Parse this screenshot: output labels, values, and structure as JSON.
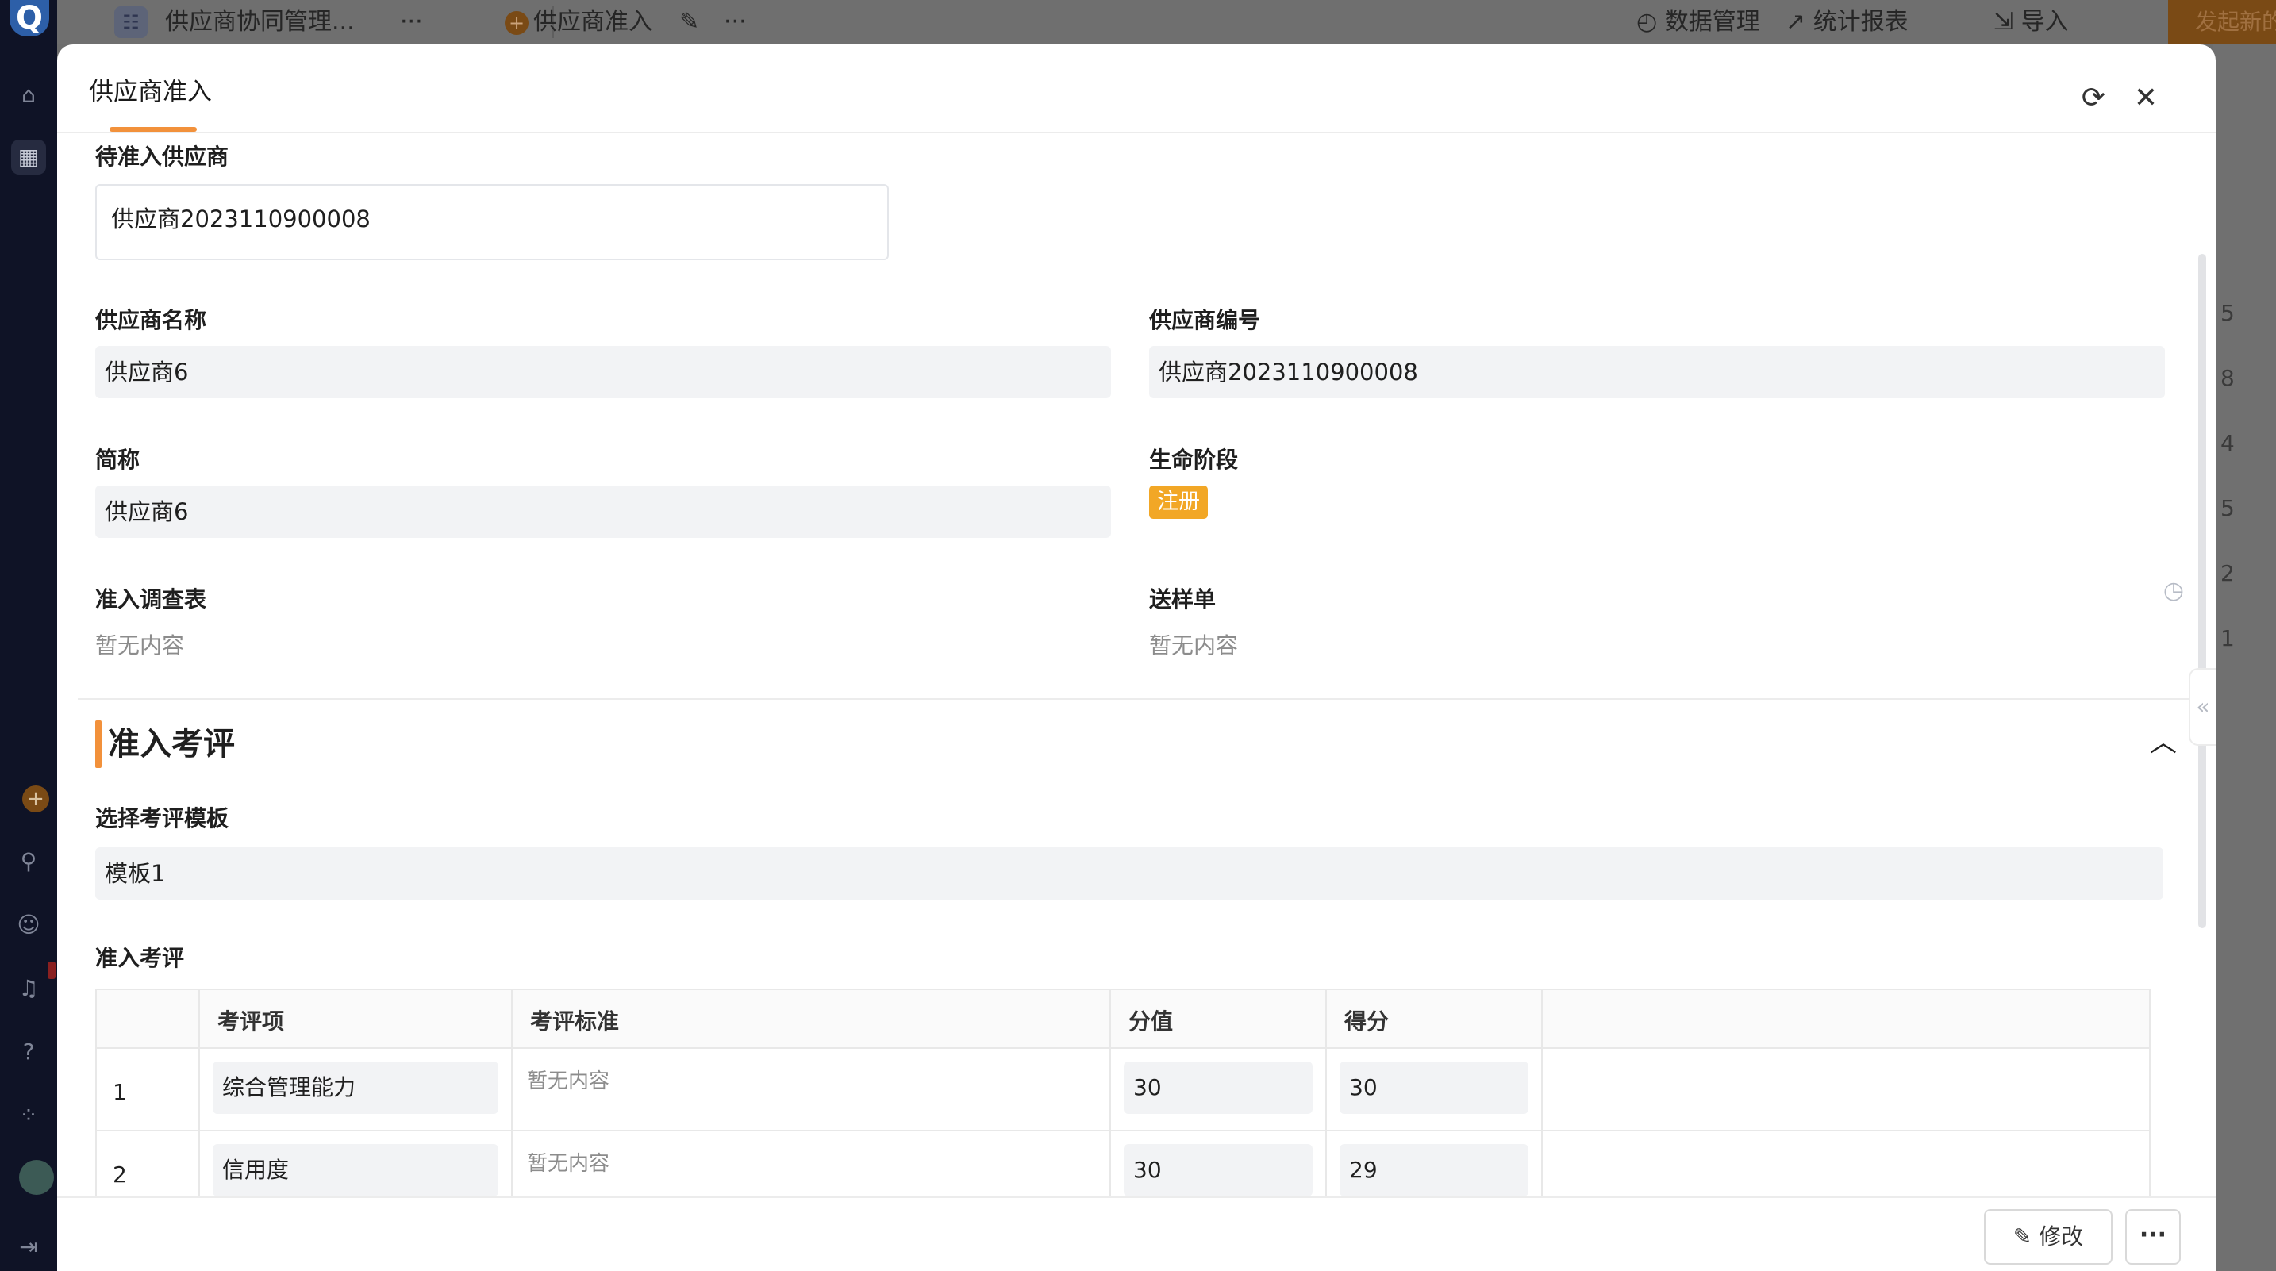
{
  "background": {
    "rail_logo": "Q",
    "topbar": {
      "app_name": "供应商协同管理...",
      "app_more": "···",
      "page_name": "供应商准入",
      "page_more": "···",
      "data_manage": "数据管理",
      "reports": "统计报表",
      "import": "导入",
      "start_new": "发起新的"
    },
    "right_edge_digits": [
      "5",
      "8",
      "4",
      "5",
      "2",
      "1"
    ]
  },
  "modal": {
    "title": "供应商准入",
    "fields": {
      "pending_supplier": {
        "label": "待准入供应商",
        "value": "供应商2023110900008"
      },
      "supplier_name": {
        "label": "供应商名称",
        "value": "供应商6"
      },
      "supplier_code": {
        "label": "供应商编号",
        "value": "供应商2023110900008"
      },
      "short_name": {
        "label": "简称",
        "value": "供应商6"
      },
      "lifecycle": {
        "label": "生命阶段",
        "value": "注册"
      },
      "survey": {
        "label": "准入调查表",
        "value": "暂无内容"
      },
      "sample_order": {
        "label": "送样单",
        "value": "暂无内容"
      }
    },
    "section": {
      "title": "准入考评",
      "template": {
        "label": "选择考评模板",
        "value": "模板1"
      },
      "table_label": "准入考评",
      "table": {
        "headers": [
          "考评项",
          "考评标准",
          "分值",
          "得分"
        ],
        "rows": [
          {
            "index": "1",
            "item": "综合管理能力",
            "standard": "暂无内容",
            "value": "30",
            "score": "30"
          },
          {
            "index": "2",
            "item": "信用度",
            "standard": "暂无内容",
            "value": "30",
            "score": "29"
          }
        ]
      }
    },
    "footer": {
      "edit_label": "修改",
      "more_label": "···"
    }
  },
  "colors": {
    "accent": "#f2913b",
    "tag": "#f2a726",
    "field_bg": "#f2f3f5"
  }
}
